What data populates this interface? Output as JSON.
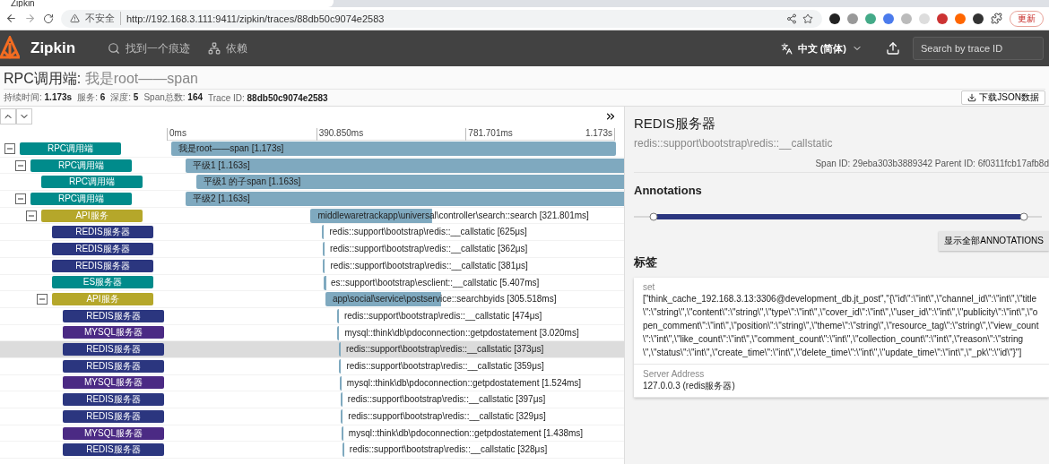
{
  "browser": {
    "tab_title": "Zipkin",
    "security": "不安全",
    "url": "http://192.168.3.111:9411/zipkin/traces/88db50c9074e2583",
    "update_button": "更新"
  },
  "header": {
    "brand": "Zipkin",
    "nav": [
      {
        "kind": "search",
        "label": "找到一个痕迹"
      },
      {
        "kind": "dependencies",
        "label": "依赖"
      }
    ],
    "language": "中文 (简体)",
    "search": {
      "placeholder": "Search by trace ID"
    }
  },
  "trace": {
    "service": "RPC调用端:",
    "name": "我是root——span",
    "stats": [
      {
        "label": "持续时间:",
        "value": "1.173s"
      },
      {
        "label": "服务:",
        "value": "6"
      },
      {
        "label": "深度:",
        "value": "5"
      },
      {
        "label": "Span总数:",
        "value": "164"
      },
      {
        "label": "Trace ID:",
        "value": "88db50c9074e2583"
      }
    ],
    "download_button": "下载JSON数据"
  },
  "timeline": {
    "ticks": [
      "0ms",
      "390.850ms",
      "781.701ms",
      "1.173s"
    ],
    "spans": [
      {
        "service": "RPC调用端",
        "color": "#008b8b",
        "label": "我是root——span [1.173s]",
        "selected": false,
        "expanded": true,
        "children": [
          {
            "service": "RPC调用端",
            "color": "#008b8b",
            "label": "平级1 [1.163s]",
            "selected": false,
            "expanded": true,
            "children": [
              {
                "service": "RPC调用端",
                "color": "#008b8b",
                "label": "平级1 的子span [1.163s]",
                "selected": false
              }
            ]
          },
          {
            "service": "RPC调用端",
            "color": "#008b8b",
            "label": "平级2 [1.163s]",
            "selected": false,
            "expanded": true,
            "children": [
              {
                "service": "API服务",
                "color": "#b5a72a",
                "label": "middlewaretrackapp\\universal\\controller\\search::search [321.801ms]",
                "selected": false,
                "expanded": true,
                "children": [
                  {
                    "service": "REDIS服务器",
                    "color": "#2b367f",
                    "label": "redis::support\\bootstrap\\redis::__callstatic [625μs]",
                    "selected": false
                  },
                  {
                    "service": "REDIS服务器",
                    "color": "#2b367f",
                    "label": "redis::support\\bootstrap\\redis::__callstatic [362μs]",
                    "selected": false
                  },
                  {
                    "service": "REDIS服务器",
                    "color": "#2b367f",
                    "label": "redis::support\\bootstrap\\redis::__callstatic [381μs]",
                    "selected": false
                  },
                  {
                    "service": "ES服务器",
                    "color": "#008b8b",
                    "label": "es::support\\bootstrap\\esclient::__callstatic [5.407ms]",
                    "selected": false
                  },
                  {
                    "service": "API服务",
                    "color": "#b5a72a",
                    "label": "app\\social\\service\\postservice::searchbyids [305.518ms]",
                    "selected": false,
                    "expanded": true,
                    "children": [
                      {
                        "service": "REDIS服务器",
                        "color": "#2b367f",
                        "label": "redis::support\\bootstrap\\redis::__callstatic [474μs]",
                        "selected": false
                      },
                      {
                        "service": "MYSQL服务器",
                        "color": "#4b2a84",
                        "label": "mysql::think\\db\\pdoconnection::getpdostatement [3.020ms]",
                        "selected": false
                      },
                      {
                        "service": "REDIS服务器",
                        "color": "#2b367f",
                        "label": "redis::support\\bootstrap\\redis::__callstatic [373μs]",
                        "selected": true
                      },
                      {
                        "service": "REDIS服务器",
                        "color": "#2b367f",
                        "label": "redis::support\\bootstrap\\redis::__callstatic [359μs]",
                        "selected": false
                      },
                      {
                        "service": "MYSQL服务器",
                        "color": "#4b2a84",
                        "label": "mysql::think\\db\\pdoconnection::getpdostatement [1.524ms]",
                        "selected": false
                      },
                      {
                        "service": "REDIS服务器",
                        "color": "#2b367f",
                        "label": "redis::support\\bootstrap\\redis::__callstatic [397μs]",
                        "selected": false
                      },
                      {
                        "service": "REDIS服务器",
                        "color": "#2b367f",
                        "label": "redis::support\\bootstrap\\redis::__callstatic [329μs]",
                        "selected": false
                      },
                      {
                        "service": "MYSQL服务器",
                        "color": "#4b2a84",
                        "label": "mysql::think\\db\\pdoconnection::getpdostatement [1.438ms]",
                        "selected": false
                      },
                      {
                        "service": "REDIS服务器",
                        "color": "#2b367f",
                        "label": "redis::support\\bootstrap\\redis::__callstatic [328μs]",
                        "selected": false
                      }
                    ]
                  }
                ]
              }
            ]
          }
        ]
      }
    ]
  },
  "detail": {
    "service": "REDIS服务器",
    "name": "redis::support\\bootstrap\\redis::__callstatic",
    "ids": "Span ID: 29eba303b3889342  Parent ID: 6f0311fcb17afb8d",
    "annotations_title": "Annotations",
    "show_all_button": "显示全部ANNOTATIONS",
    "tags_title": "标签",
    "tags": [
      {
        "key": "set",
        "value": "[\"think_cache_192.168.3.13:3306@development_db.jt_post\",\"{\\\"id\\\":\\\"int\\\",\\\"channel_id\\\":\\\"int\\\",\\\"title\\\":\\\"string\\\",\\\"content\\\":\\\"string\\\",\\\"type\\\":\\\"int\\\",\\\"cover_id\\\":\\\"int\\\",\\\"user_id\\\":\\\"int\\\",\\\"publicity\\\":\\\"int\\\",\\\"open_comment\\\":\\\"int\\\",\\\"position\\\":\\\"string\\\",\\\"theme\\\":\\\"string\\\",\\\"resource_tag\\\":\\\"string\\\",\\\"view_count\\\":\\\"int\\\",\\\"like_count\\\":\\\"int\\\",\\\"comment_count\\\":\\\"int\\\",\\\"collection_count\\\":\\\"int\\\",\\\"reason\\\":\\\"string\\\",\\\"status\\\":\\\"int\\\",\\\"create_time\\\":\\\"int\\\",\\\"delete_time\\\":\\\"int\\\",\\\"update_time\\\":\\\"int\\\",\\\"_pk\\\":\\\"id\\\"}\"]"
      },
      {
        "key": "Server Address",
        "value": "127.0.0.3 (redis服务器)"
      }
    ]
  }
}
